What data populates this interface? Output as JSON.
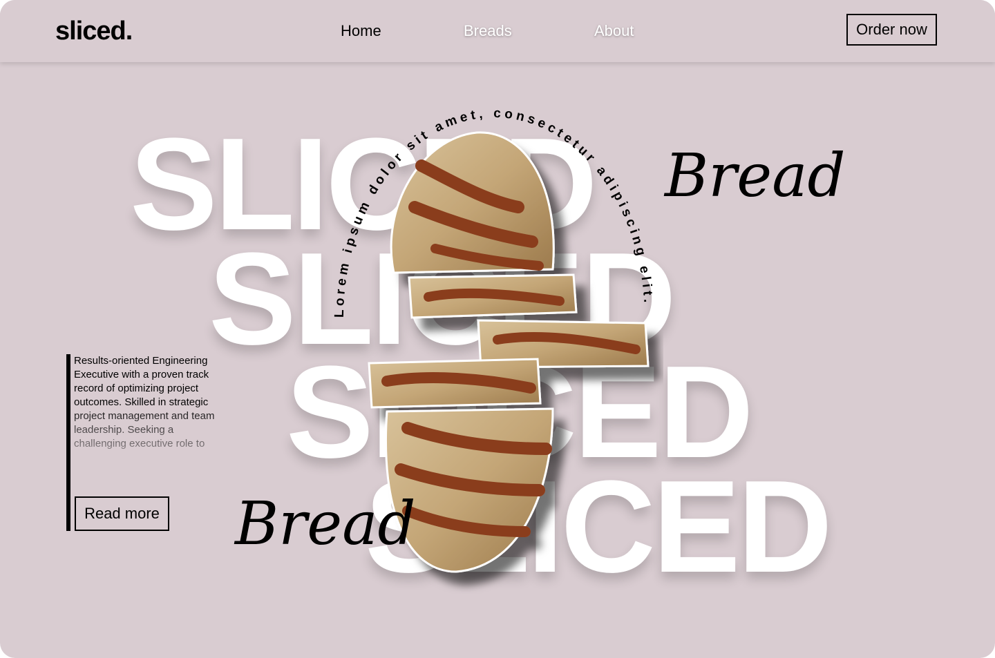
{
  "header": {
    "logo": "sliced.",
    "nav": [
      {
        "label": "Home"
      },
      {
        "label": "Breads"
      },
      {
        "label": "About"
      }
    ],
    "cta_label": "Order now"
  },
  "hero": {
    "big_words": [
      "SLICED",
      "SLICED",
      "SLICED",
      "SLICED"
    ],
    "arc_text": "Lorem ipsum dolor sit amet, consectetur adipiscing elit.",
    "script_top": "Bread",
    "script_bottom": "Bread"
  },
  "sidebar": {
    "description": "Results-oriented Engineering Executive with a proven track record of optimizing project outcomes. Skilled in strategic project management and team leadership. Seeking a challenging executive role to",
    "read_more_label": "Read more"
  },
  "colors": {
    "background": "#d9ccd1",
    "text": "#000000",
    "big_text": "#ffffff"
  }
}
